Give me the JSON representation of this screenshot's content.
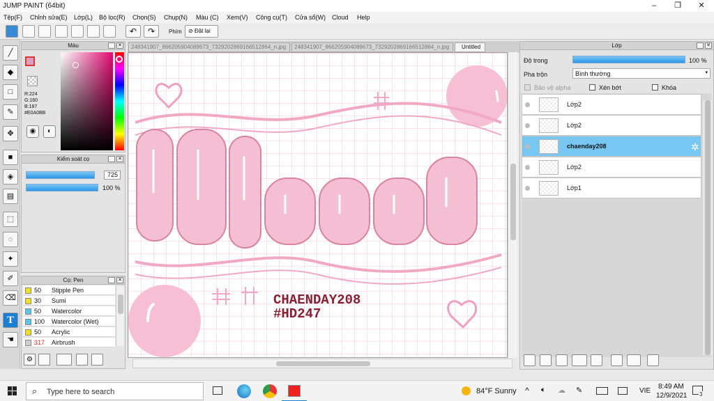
{
  "app": {
    "title": "JUMP PAINT (64bit)"
  },
  "menu": [
    "Tệp(F)",
    "Chỉnh sửa(E)",
    "Lớp(L)",
    "Bộ lọc(R)",
    "Chọn(S)",
    "Chụp(N)",
    "Màu (C)",
    "Xem(V)",
    "Công cụ(T)",
    "Cửa sổ(W)",
    "Cloud",
    "Help"
  ],
  "toolbar": {
    "phim_label": "Phím",
    "reset_label": "Đặt lại"
  },
  "color_panel": {
    "title": "Màu",
    "r": "R:224",
    "g": "G:160",
    "b": "B:187",
    "hex": "#E0A0BB",
    "primary_color": "#e0a0bb"
  },
  "brush_control": {
    "title": "Kiểm soát cọ",
    "size": "725",
    "opacity": "100 %",
    "size_fraction": 0.95,
    "opacity_fraction": 1.0
  },
  "brush_list": {
    "title": "Cọ: Pen",
    "items": [
      {
        "size": "50",
        "name": "Stipple Pen",
        "color": "#f0e020"
      },
      {
        "size": "30",
        "name": "Sumi",
        "color": "#f0e020"
      },
      {
        "size": "50",
        "name": "Watercolor",
        "color": "#59c4ee"
      },
      {
        "size": "100",
        "name": "Watercolor (Wet)",
        "color": "#59c4ee"
      },
      {
        "size": "50",
        "name": "Acrylic",
        "color": "#f0e020"
      },
      {
        "size": "317",
        "name": "Airbrush",
        "color": "#cfcfcf"
      }
    ]
  },
  "doc_tabs": [
    "248341907_866205904089673_7329202869166512864_n.jpg",
    "248341907_866205904089673_7329202869166512864_n.jpg",
    "Untitled"
  ],
  "canvas": {
    "text_line1": "CHAENDAY208",
    "text_line2": "#HD247",
    "pink": "#f4bfd3",
    "outline": "#8a1f33"
  },
  "layer_panel": {
    "title": "Lớp",
    "opacity_label": "Độ trong",
    "opacity_value": "100 %",
    "blend_label": "Pha trộn",
    "blend_value": "Bình thường",
    "opt_alpha": "Bảo vệ alpha",
    "opt_clip": "Xén bớt",
    "opt_lock": "Khóa",
    "layers": [
      {
        "name": "Lớp2",
        "selected": false,
        "bold": false
      },
      {
        "name": "Lớp2",
        "selected": false,
        "bold": false
      },
      {
        "name": "chaenday208",
        "selected": true,
        "bold": true
      },
      {
        "name": "Lớp2",
        "selected": false,
        "bold": false
      },
      {
        "name": "Lớp1",
        "selected": false,
        "bold": false
      }
    ]
  },
  "taskbar": {
    "search_placeholder": "Type here to search",
    "weather": "84°F  Sunny",
    "lang": "VIE",
    "time": "8:49 AM",
    "date": "12/9/2021",
    "notifications": "3"
  }
}
